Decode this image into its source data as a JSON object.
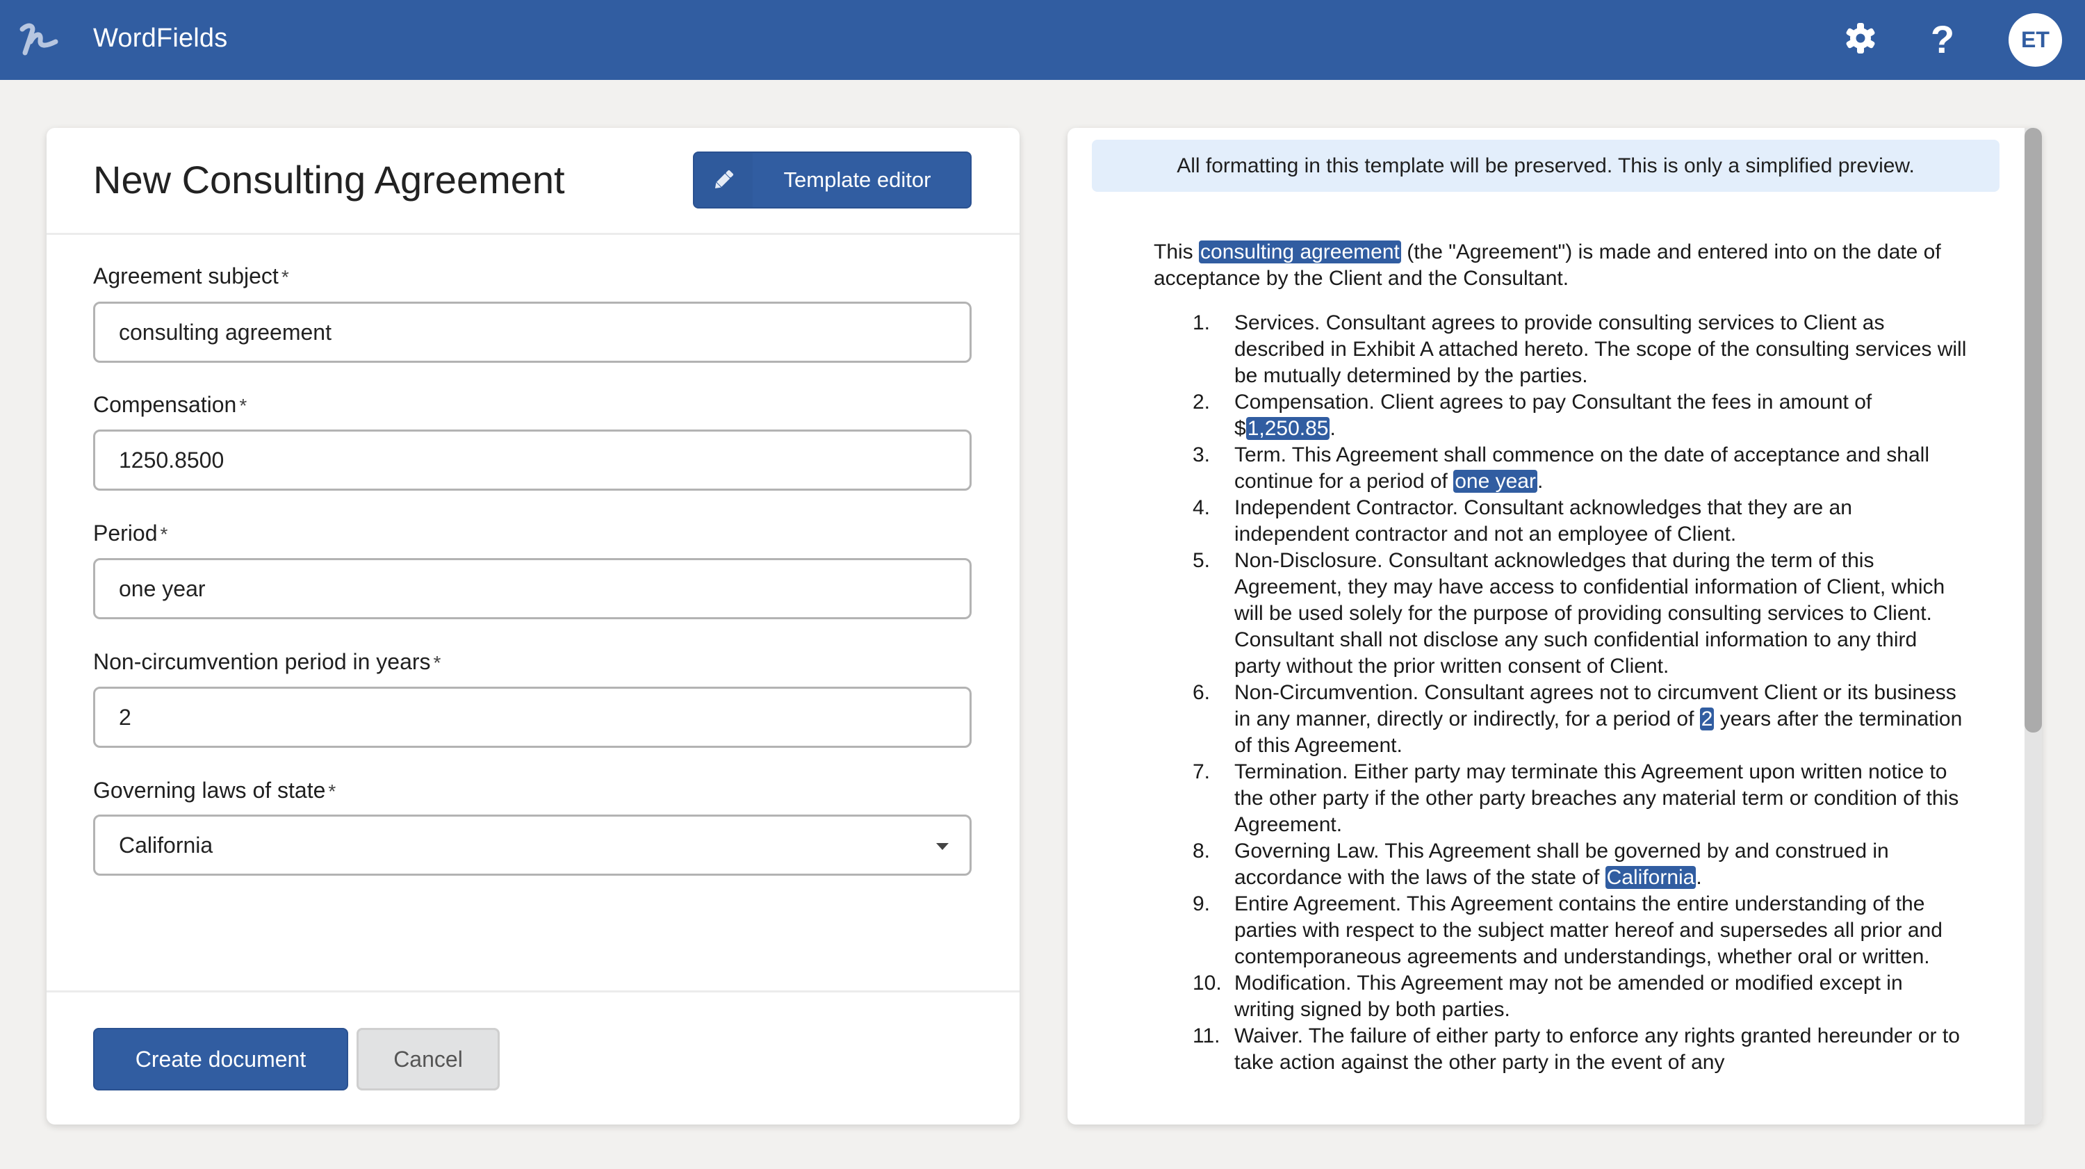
{
  "header": {
    "app_name": "WordFields",
    "logo_icon": "wordfields-logo-icon",
    "settings_icon": "gear-icon",
    "help_icon": "question-mark-icon",
    "help_glyph": "?",
    "avatar_initials": "ET",
    "brand_color": "#315da1"
  },
  "form": {
    "title": "New Consulting Agreement",
    "template_editor_label": "Template editor",
    "template_editor_icon": "pencil-icon",
    "required_marker": "*",
    "fields": [
      {
        "label": "Agreement subject",
        "value": "consulting agreement",
        "type": "text"
      },
      {
        "label": "Compensation",
        "value": "1250.8500",
        "type": "text"
      },
      {
        "label": "Period",
        "value": "one year",
        "type": "text"
      },
      {
        "label": "Non-circumvention period in years",
        "value": "2",
        "type": "text"
      },
      {
        "label": "Governing laws of state",
        "value": "California",
        "type": "select"
      }
    ],
    "create_label": "Create document",
    "cancel_label": "Cancel"
  },
  "preview": {
    "banner": "All formatting in this template will be preserved. This is only a simplified preview.",
    "intro": {
      "before": "This ",
      "highlight": "consulting agreement",
      "after": " (the \"Agreement\") is made and entered into on the date of acceptance by the Client and the Consultant."
    },
    "clauses": [
      {
        "num": "1.",
        "before": "Services. Consultant agrees to provide consulting services to Client as described in Exhibit A attached hereto. The scope of the consulting services will be mutually determined by the parties.",
        "highlight": "",
        "after": ""
      },
      {
        "num": "2.",
        "before": "Compensation. Client agrees to pay Consultant the fees in amount of $",
        "highlight": "1,250.85",
        "after": "."
      },
      {
        "num": "3.",
        "before": "Term. This Agreement shall commence on the date of acceptance and shall continue for a period of ",
        "highlight": "one year",
        "after": "."
      },
      {
        "num": "4.",
        "before": "Independent Contractor. Consultant acknowledges that they are an independent contractor and not an employee of Client.",
        "highlight": "",
        "after": ""
      },
      {
        "num": "5.",
        "before": "Non-Disclosure. Consultant acknowledges that during the term of this Agreement, they may have access to confidential information of Client, which will be used solely for the purpose of providing consulting services to Client. Consultant shall not disclose any such confidential information to any third party without the prior written consent of Client.",
        "highlight": "",
        "after": ""
      },
      {
        "num": "6.",
        "before": "Non-Circumvention. Consultant agrees not to circumvent Client or its business in any manner, directly or indirectly, for a period of ",
        "highlight": "2",
        "after": " years after the termination of this Agreement."
      },
      {
        "num": "7.",
        "before": "Termination. Either party may terminate this Agreement upon written notice to the other party if the other party breaches any material term or condition of this Agreement.",
        "highlight": "",
        "after": ""
      },
      {
        "num": "8.",
        "before": "Governing Law. This Agreement shall be governed by and construed in accordance with the laws of the state of ",
        "highlight": "California",
        "after": "."
      },
      {
        "num": "9.",
        "before": "Entire Agreement. This Agreement contains the entire understanding of the parties with respect to the subject matter hereof and supersedes all prior and contemporaneous agreements and understandings, whether oral or written.",
        "highlight": "",
        "after": ""
      },
      {
        "num": "10.",
        "before": "Modification. This Agreement may not be amended or modified except in writing signed by both parties.",
        "highlight": "",
        "after": ""
      },
      {
        "num": "11.",
        "before": "Waiver. The failure of either party to enforce any rights granted hereunder or to take action against the other party in the event of any",
        "highlight": "",
        "after": ""
      }
    ],
    "scroll_position_fraction": 0
  }
}
